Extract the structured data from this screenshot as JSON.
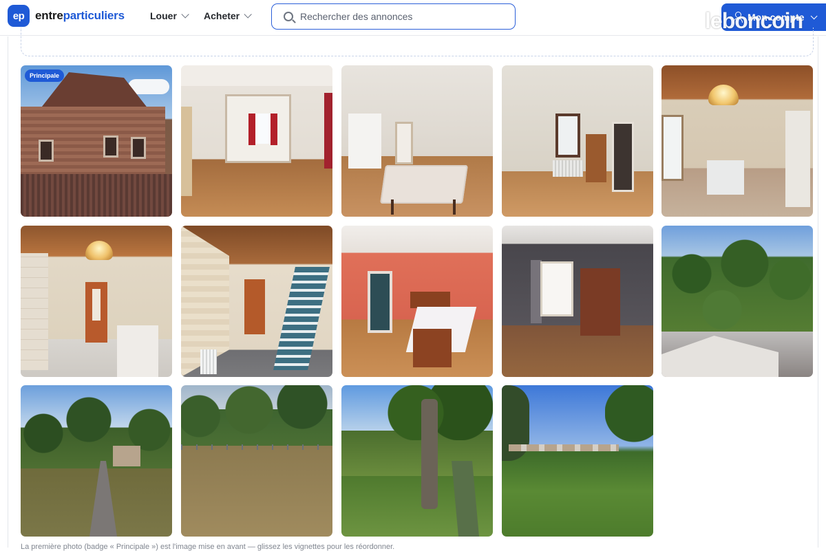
{
  "header": {
    "logo_badge": "ep",
    "logo_text_part1": "entre",
    "logo_text_part2": "particuliers",
    "nav": [
      {
        "label": "Louer",
        "icon": "chevron-down-icon"
      },
      {
        "label": "Acheter",
        "icon": "chevron-down-icon"
      }
    ],
    "search": {
      "placeholder": "Rechercher des annonces",
      "value": ""
    },
    "account": {
      "label": "Mon compte",
      "icon": "user-icon"
    },
    "watermark": "leboncoin"
  },
  "colors": {
    "brand": "#1f5ad6",
    "border": "#e3e6ea"
  },
  "gallery": {
    "main_badge": "Principale",
    "photos": [
      {
        "subject": "house-exterior"
      },
      {
        "subject": "living-room"
      },
      {
        "subject": "dining-room"
      },
      {
        "subject": "bedroom-wardrobe"
      },
      {
        "subject": "kitchen"
      },
      {
        "subject": "kitchen-door"
      },
      {
        "subject": "stairs-corridor"
      },
      {
        "subject": "bedroom-salmon"
      },
      {
        "subject": "bedroom-grey"
      },
      {
        "subject": "garden-view"
      },
      {
        "subject": "garden-path"
      },
      {
        "subject": "lawn"
      },
      {
        "subject": "tree-stream"
      },
      {
        "subject": "wide-lawn"
      }
    ],
    "caption": "La première photo (badge « Principale ») est l'image mise en avant — glissez les vignettes pour les réordonner."
  }
}
